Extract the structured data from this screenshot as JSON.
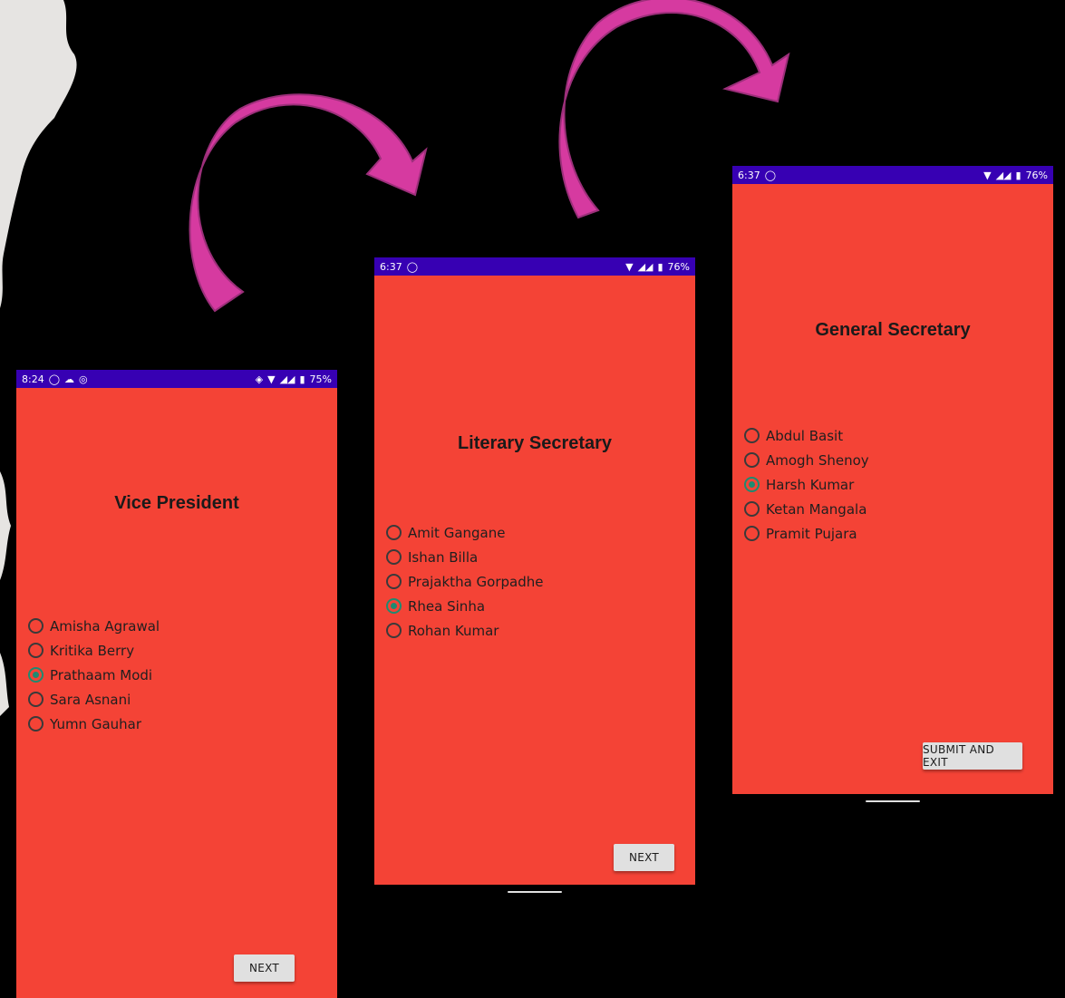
{
  "screens": [
    {
      "status": {
        "time": "8:24",
        "left_icons": [
          "whatsapp-icon",
          "cloud-icon",
          "sync-icon"
        ],
        "battery": "75%"
      },
      "title": "Vice President",
      "options": [
        "Amisha Agrawal",
        "Kritika Berry",
        "Prathaam Modi",
        "Sara Asnani",
        "Yumn Gauhar"
      ],
      "selected_index": 2,
      "button": "NEXT"
    },
    {
      "status": {
        "time": "6:37",
        "left_icons": [
          "viber-icon"
        ],
        "battery": "76%"
      },
      "title": "Literary Secretary",
      "options": [
        "Amit Gangane",
        "Ishan Billa",
        "Prajaktha Gorpadhe",
        "Rhea Sinha",
        "Rohan Kumar"
      ],
      "selected_index": 3,
      "button": "NEXT"
    },
    {
      "status": {
        "time": "6:37",
        "left_icons": [
          "viber-icon"
        ],
        "battery": "76%"
      },
      "title": "General Secretary",
      "options": [
        "Abdul Basit",
        "Amogh Shenoy",
        "Harsh Kumar",
        "Ketan Mangala",
        "Pramit Pujara"
      ],
      "selected_index": 2,
      "button": "SUBMIT AND EXIT"
    }
  ],
  "colors": {
    "background": "#000000",
    "screen": "#f44336",
    "status_bar": "#3700b3",
    "radio_checked": "#1f8a70",
    "arrow": "#d63aa0"
  }
}
